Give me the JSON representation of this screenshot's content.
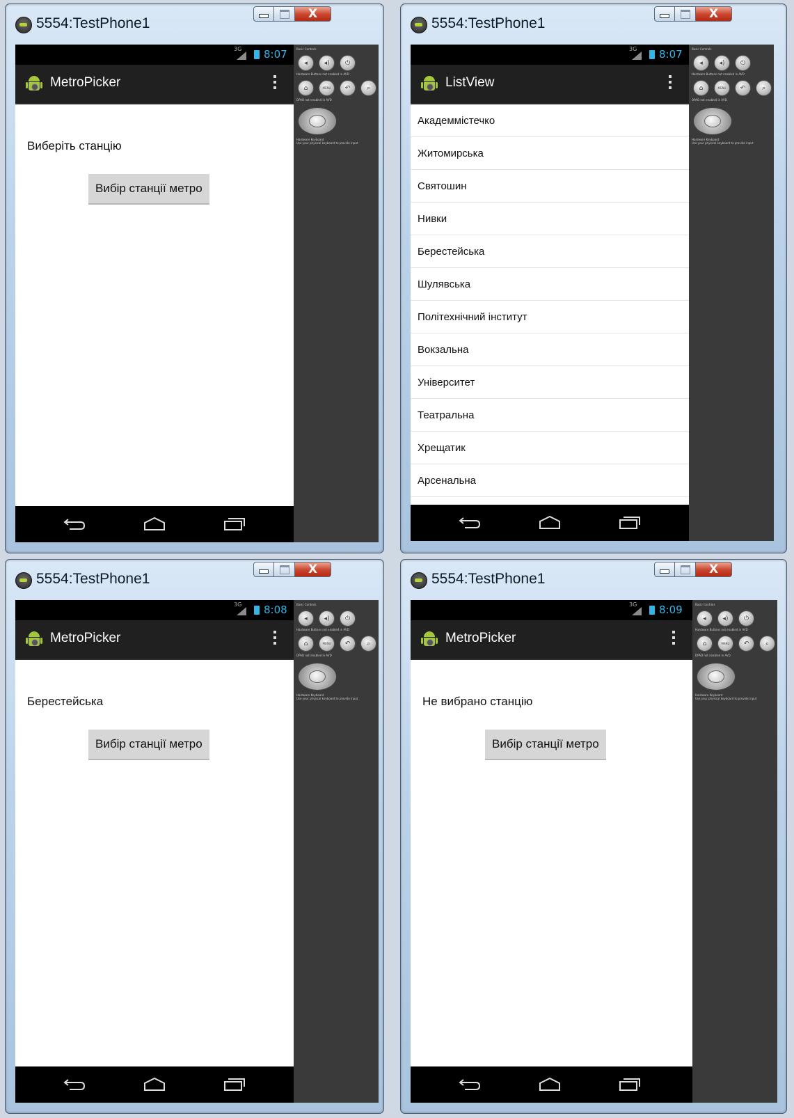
{
  "windows": [
    {
      "title": "5554:TestPhone1",
      "time": "8:07",
      "signal": "3G",
      "app_title": "MetroPicker",
      "label": "Виберіть станцію",
      "button": "Вибір станції метро"
    },
    {
      "title": "5554:TestPhone1",
      "time": "8:07",
      "signal": "3G",
      "app_title": "ListView",
      "stations": [
        "Академмістечко",
        "Житомирська",
        "Святошин",
        "Нивки",
        "Берестейська",
        "Шулявська",
        "Політехнічний інститут",
        "Вокзальна",
        "Університет",
        "Театральна",
        "Хрещатик",
        "Арсенальна"
      ]
    },
    {
      "title": "5554:TestPhone1",
      "time": "8:08",
      "signal": "3G",
      "app_title": "MetroPicker",
      "label": "Берестейська",
      "button": "Вибір станції метро"
    },
    {
      "title": "5554:TestPhone1",
      "time": "8:09",
      "signal": "3G",
      "app_title": "MetroPicker",
      "label": "Не вибрано станцію",
      "button": "Вибір станції метро"
    }
  ],
  "emulator_panel": {
    "basic_controls": "Basic Controls",
    "hardware_buttons": "Hardware Buttons not enabled in AVD",
    "dpad": "DPAD not enabled in AVD",
    "keyboard_title": "Hardware Keyboard",
    "keyboard_hint": "Use your physical keyboard to provide input",
    "menu_label": "MENU"
  },
  "window_controls": {
    "close": "X"
  },
  "colors": {
    "accent": "#33b5e5",
    "android_green": "#a4c639",
    "action_bar": "#202020"
  }
}
